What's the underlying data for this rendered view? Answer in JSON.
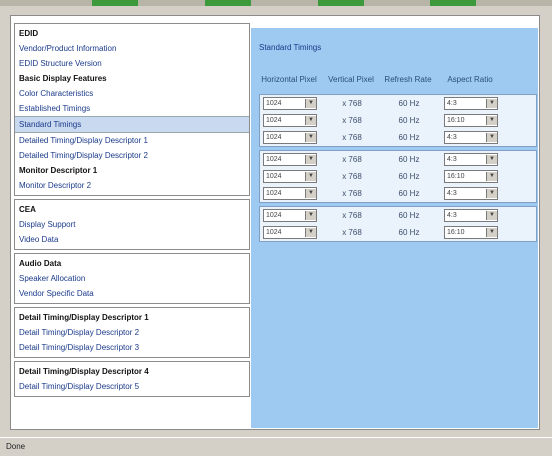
{
  "sidebar": {
    "groups": [
      {
        "items": [
          {
            "label": "EDID",
            "kind": "header"
          },
          {
            "label": "Vendor/Product Information",
            "kind": "link"
          },
          {
            "label": "EDID Structure Version",
            "kind": "link"
          },
          {
            "label": "Basic Display Features",
            "kind": "header"
          },
          {
            "label": "Color Characteristics",
            "kind": "link"
          },
          {
            "label": "Established Timings",
            "kind": "link"
          },
          {
            "label": "Standard Timings",
            "kind": "sel"
          },
          {
            "label": "Detailed Timing/Display Descriptor 1",
            "kind": "link"
          },
          {
            "label": "Detailed Timing/Display Descriptor 2",
            "kind": "link"
          },
          {
            "label": "Monitor Descriptor 1",
            "kind": "header"
          },
          {
            "label": "Monitor Descriptor 2",
            "kind": "link"
          }
        ]
      },
      {
        "items": [
          {
            "label": "CEA",
            "kind": "header"
          },
          {
            "label": "Display Support",
            "kind": "link"
          },
          {
            "label": "Video Data",
            "kind": "link"
          }
        ]
      },
      {
        "items": [
          {
            "label": "Audio Data",
            "kind": "header"
          },
          {
            "label": "Speaker Allocation",
            "kind": "link"
          },
          {
            "label": "Vendor Specific Data",
            "kind": "link"
          }
        ]
      },
      {
        "items": [
          {
            "label": "Detail Timing/Display Descriptor 1",
            "kind": "header"
          },
          {
            "label": "Detail Timing/Display Descriptor 2",
            "kind": "link"
          },
          {
            "label": "Detail Timing/Display Descriptor 3",
            "kind": "link"
          }
        ]
      },
      {
        "items": [
          {
            "label": "Detail Timing/Display Descriptor 4",
            "kind": "header"
          },
          {
            "label": "Detail Timing/Display Descriptor 5",
            "kind": "link"
          }
        ]
      }
    ]
  },
  "main": {
    "title": "Standard Timings",
    "headers": [
      "Horizontal Pixel",
      "Vertical Pixel",
      "Refresh Rate",
      "Aspect Ratio"
    ],
    "groups": [
      [
        {
          "h": "1024",
          "v": "x 768",
          "r": "60 Hz",
          "a": "4:3"
        },
        {
          "h": "1024",
          "v": "x 768",
          "r": "60 Hz",
          "a": "16:10"
        },
        {
          "h": "1024",
          "v": "x 768",
          "r": "60 Hz",
          "a": "4:3"
        }
      ],
      [
        {
          "h": "1024",
          "v": "x 768",
          "r": "60 Hz",
          "a": "4:3"
        },
        {
          "h": "1024",
          "v": "x 768",
          "r": "60 Hz",
          "a": "16:10"
        },
        {
          "h": "1024",
          "v": "x 768",
          "r": "60 Hz",
          "a": "4:3"
        }
      ],
      [
        {
          "h": "1024",
          "v": "x 768",
          "r": "60 Hz",
          "a": "4:3"
        },
        {
          "h": "1024",
          "v": "x 768",
          "r": "60 Hz",
          "a": "16:10"
        }
      ]
    ]
  },
  "status": {
    "text": "Done"
  },
  "icons": {
    "dropdown": "dropdown-arrow-icon"
  }
}
